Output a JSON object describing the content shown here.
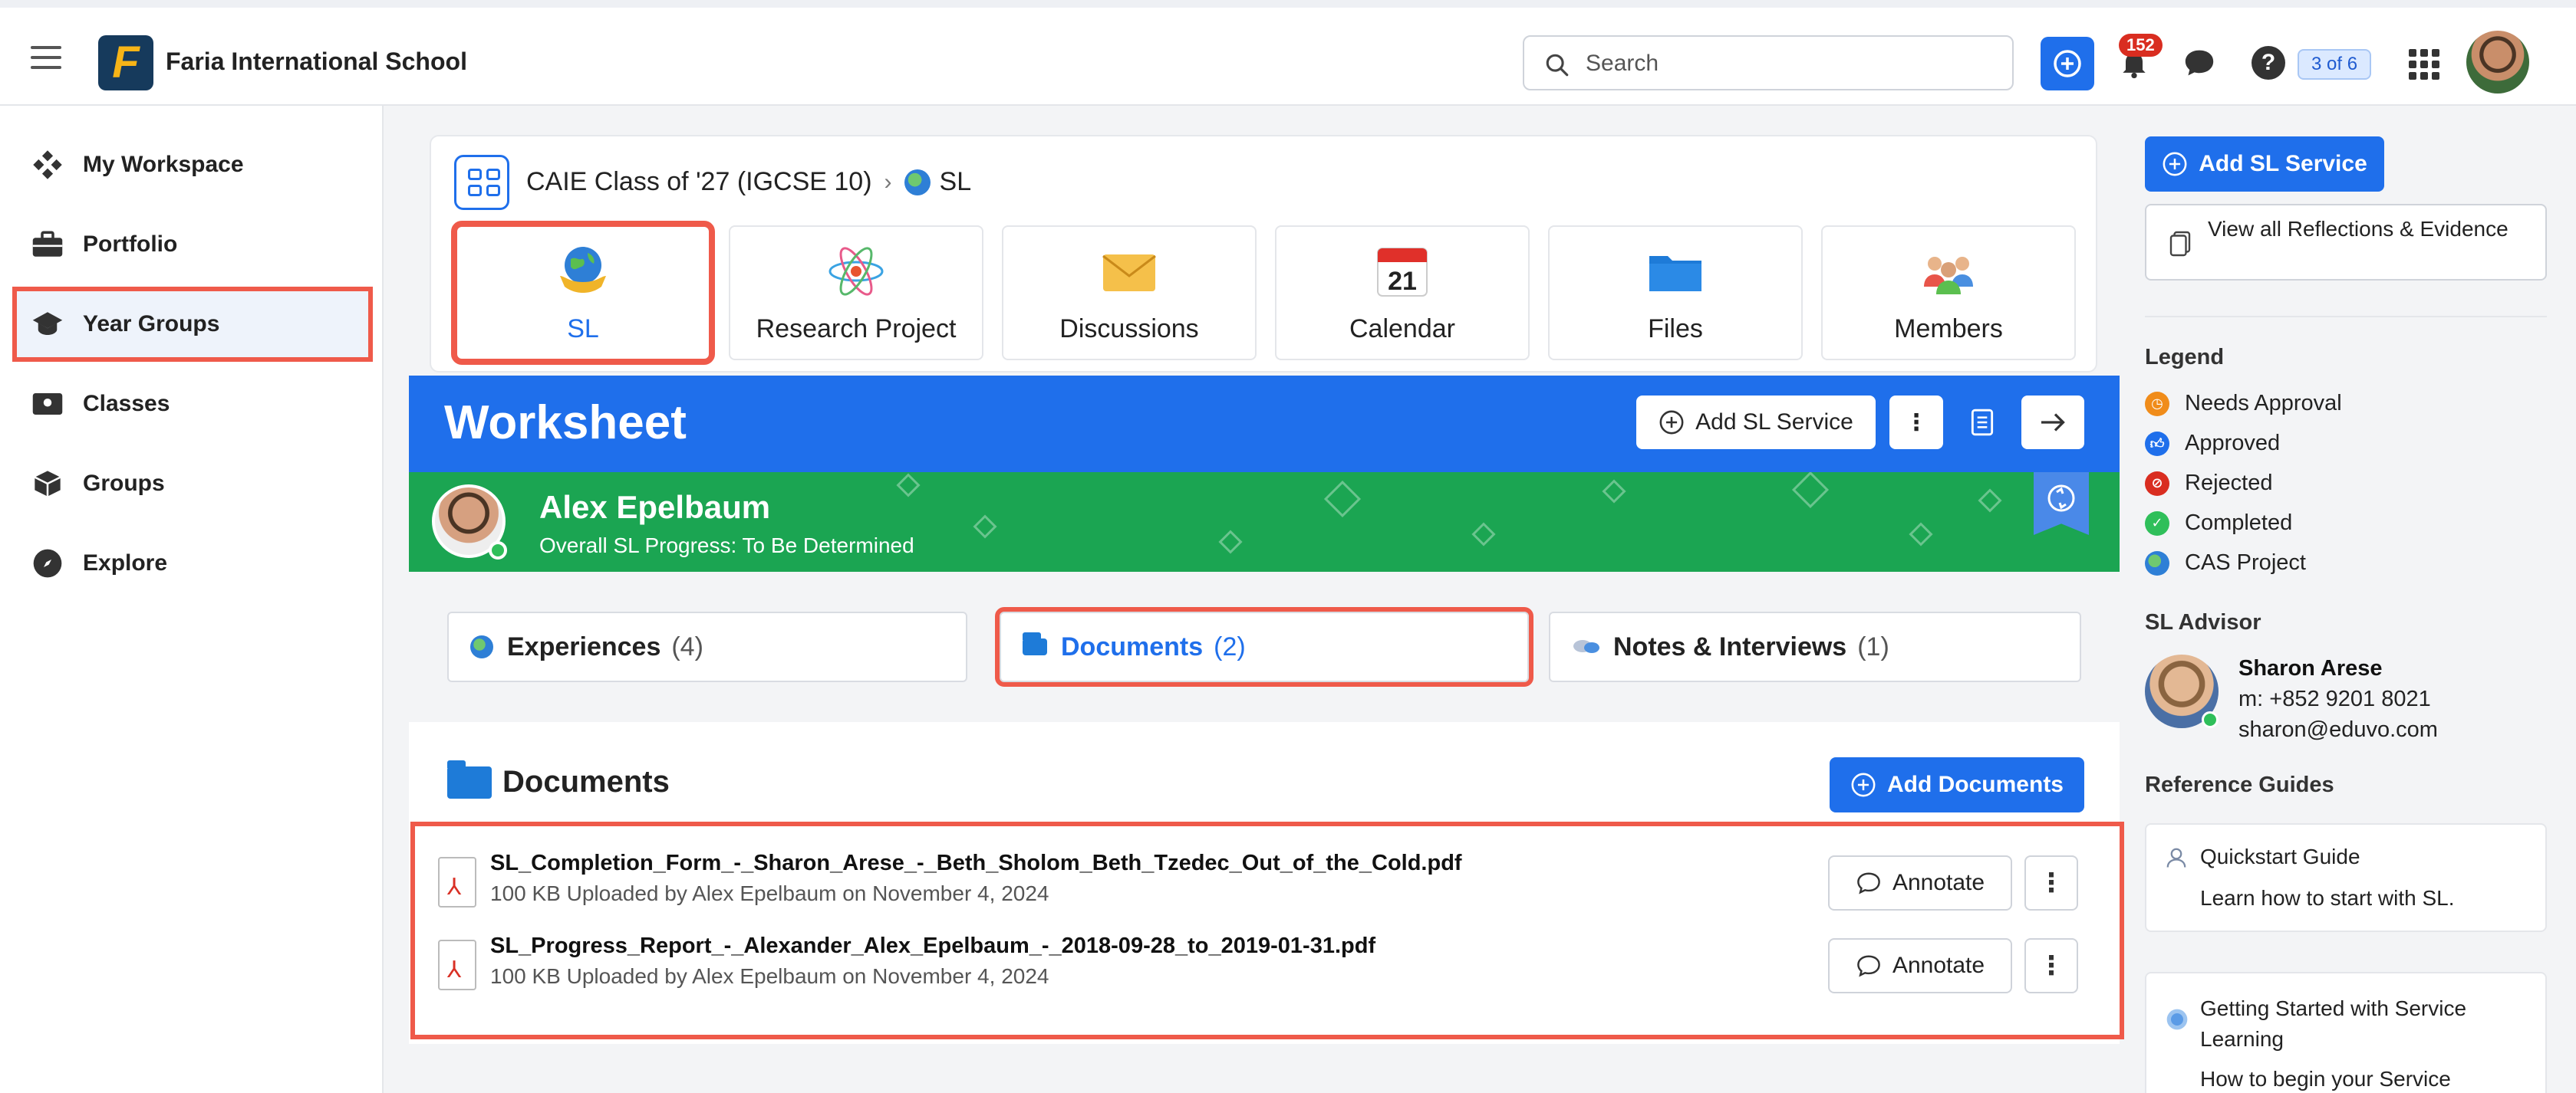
{
  "header": {
    "school_name": "Faria International School",
    "logo_letter": "F",
    "search_placeholder": "Search",
    "notification_count": "152",
    "help_steps": "3 of 6",
    "accent": "#1f6feb"
  },
  "sidebar": {
    "items": [
      {
        "label": "My Workspace",
        "icon": "diamond-grid-icon"
      },
      {
        "label": "Portfolio",
        "icon": "briefcase-icon"
      },
      {
        "label": "Year Groups",
        "icon": "graduation-cap-icon",
        "active": true
      },
      {
        "label": "Classes",
        "icon": "class-icon"
      },
      {
        "label": "Groups",
        "icon": "cube-icon"
      },
      {
        "label": "Explore",
        "icon": "compass-icon"
      }
    ]
  },
  "breadcrumb": {
    "parent": "CAIE Class of '27 (IGCSE 10)",
    "separator": "›",
    "current": "SL"
  },
  "tiles": [
    {
      "label": "SL",
      "icon": "globe-hands-icon",
      "active": true
    },
    {
      "label": "Research Project",
      "icon": "atom-icon"
    },
    {
      "label": "Discussions",
      "icon": "envelope-icon"
    },
    {
      "label": "Calendar",
      "icon": "calendar-icon",
      "day": "21"
    },
    {
      "label": "Files",
      "icon": "folder-icon"
    },
    {
      "label": "Members",
      "icon": "people-icon"
    }
  ],
  "worksheet": {
    "title": "Worksheet",
    "add_button": "Add SL Service"
  },
  "student": {
    "name": "Alex Epelbaum",
    "progress": "Overall SL Progress: To Be Determined"
  },
  "section_tabs": [
    {
      "label": "Experiences",
      "count": "(4)"
    },
    {
      "label": "Documents",
      "count": "(2)",
      "active": true
    },
    {
      "label": "Notes & Interviews",
      "count": "(1)"
    }
  ],
  "documents": {
    "title": "Documents",
    "add_button": "Add Documents",
    "annotate_label": "Annotate",
    "rows": [
      {
        "name": "SL_Completion_Form_-_Sharon_Arese_-_Beth_Sholom_Beth_Tzedec_Out_of_the_Cold.pdf",
        "meta": "100 KB Uploaded by Alex Epelbaum on November 4, 2024"
      },
      {
        "name": "SL_Progress_Report_-_Alexander_Alex_Epelbaum_-_2018-09-28_to_2019-01-31.pdf",
        "meta": "100 KB Uploaded by Alex Epelbaum on November 4, 2024"
      }
    ]
  },
  "right": {
    "add_button": "Add SL Service",
    "view_all": "View all Reflections & Evidence",
    "legend_title": "Legend",
    "legend": [
      {
        "label": "Needs Approval",
        "color": "#f08c1a"
      },
      {
        "label": "Approved",
        "color": "#1f6feb"
      },
      {
        "label": "Rejected",
        "color": "#d92d20"
      },
      {
        "label": "Completed",
        "color": "#2fbf5a"
      },
      {
        "label": "CAS Project",
        "color": "#6fc86f"
      }
    ],
    "advisor_title": "SL Advisor",
    "advisor": {
      "name": "Sharon Arese",
      "phone": "m: +852 9201 8021",
      "email": "sharon@eduvo.com"
    },
    "guides_title": "Reference Guides",
    "guides": [
      {
        "title": "Quickstart Guide",
        "subtitle": "Learn how to start with SL."
      },
      {
        "title": "Getting Started with Service Learning",
        "subtitle": "How to begin your Service"
      }
    ]
  }
}
